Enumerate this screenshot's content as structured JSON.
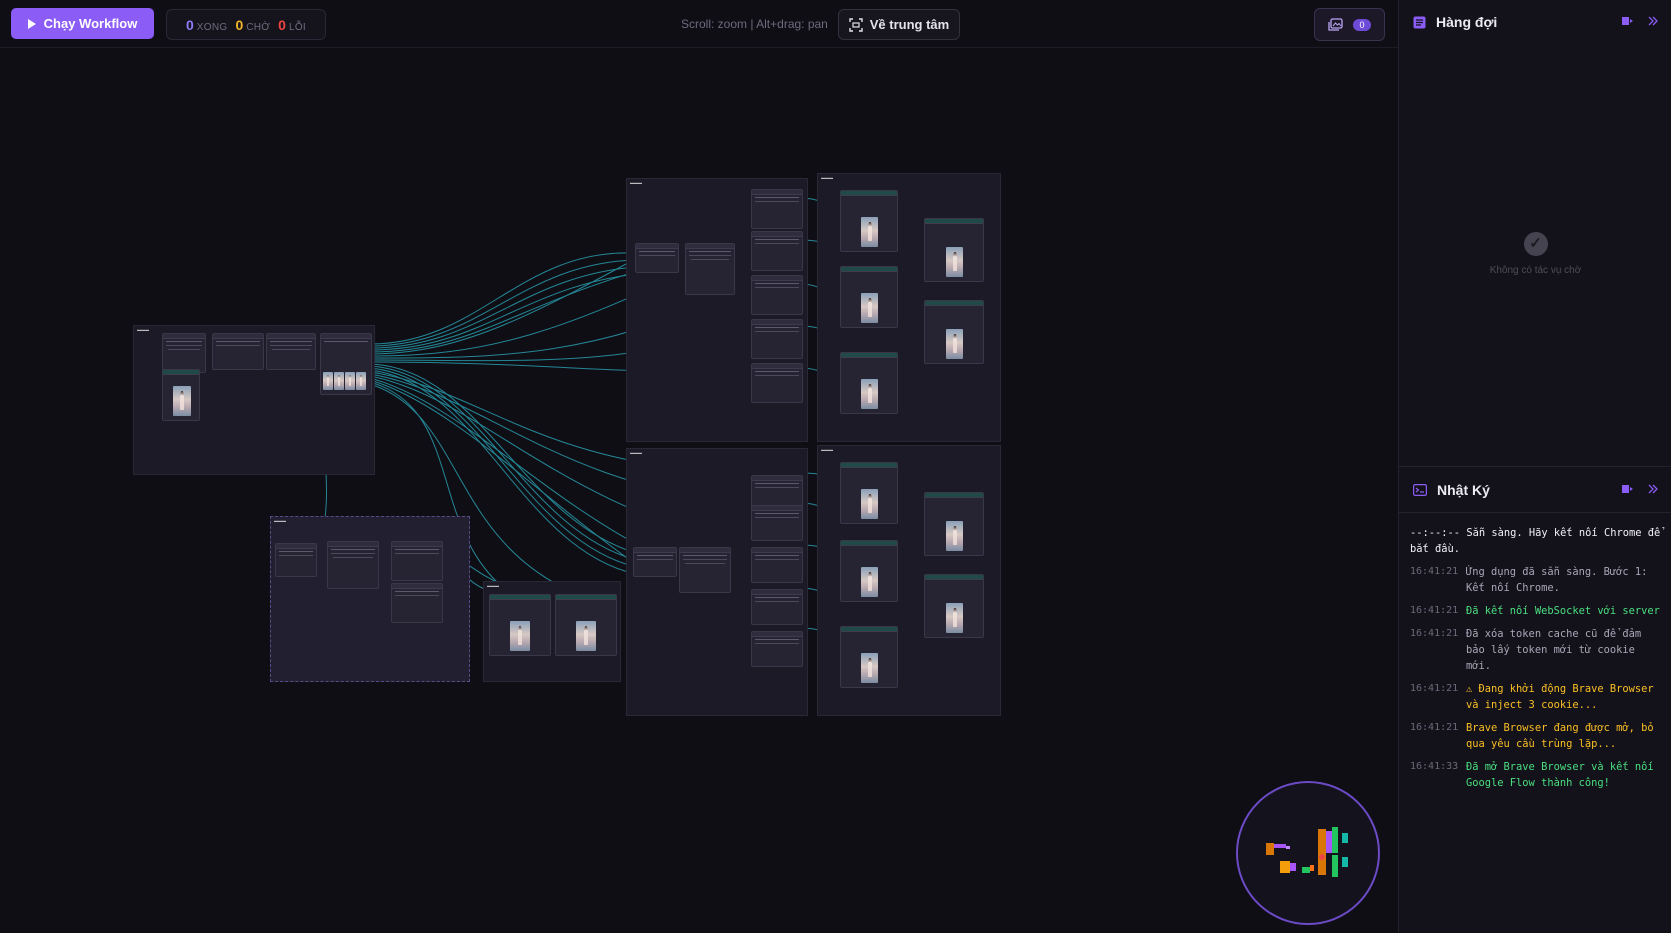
{
  "toolbar": {
    "run_label": "Chạy Workflow",
    "stats": [
      {
        "value": "0",
        "label": "XONG",
        "color": "#8b7cf6"
      },
      {
        "value": "0",
        "label": "CHỜ",
        "color": "#f0b429"
      },
      {
        "value": "0",
        "label": "LỖI",
        "color": "#ef4444"
      }
    ],
    "hint": "Scroll: zoom | Alt+drag: pan",
    "center_label": "Về trung tâm",
    "gallery_count": "0"
  },
  "queue": {
    "title": "Hàng đợi",
    "empty_text": "Không có tác vụ chờ"
  },
  "log": {
    "title": "Nhật Ký",
    "entries": [
      {
        "time": "--:--:--",
        "message": "Sẵn sàng. Hãy kết nối Chrome để bắt đầu.",
        "color": "#f2f1f6"
      },
      {
        "time": "16:41:21",
        "message": "Ứng dụng đã sẵn sàng. Bước 1: Kết nối Chrome.",
        "color": "#a9a7b8"
      },
      {
        "time": "16:41:21",
        "message": "Đã kết nối WebSocket với server",
        "color": "#4ade80"
      },
      {
        "time": "16:41:21",
        "message": "Đã xóa token cache cũ để đảm bảo lấy token mới từ cookie mới.",
        "color": "#a9a7b8"
      },
      {
        "time": "16:41:21",
        "message": "⚠ Đang khởi động Brave Browser và inject 3 cookie...",
        "color": "#fbbf24"
      },
      {
        "time": "16:41:21",
        "message": "Brave Browser đang được mở, bỏ qua yêu cầu trùng lặp...",
        "color": "#fbbf24"
      },
      {
        "time": "16:41:33",
        "message": "Đã mở Brave Browser và kết nối Google Flow thành công!",
        "color": "#4ade80"
      }
    ]
  },
  "colors": {
    "accent": "#8b5cf6",
    "edge": "#2aa6b8"
  }
}
